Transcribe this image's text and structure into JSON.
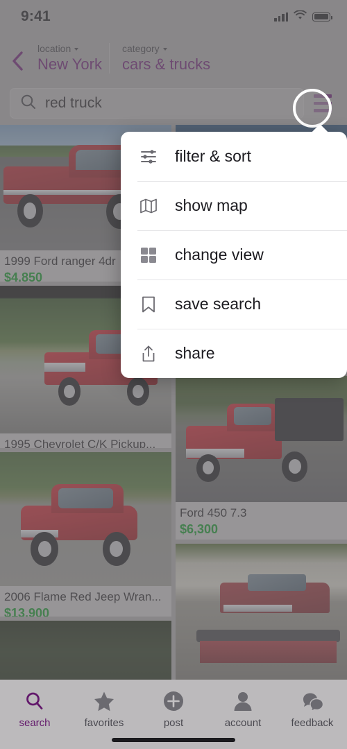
{
  "status_bar": {
    "time": "9:41",
    "icons": [
      "cellular-signal-icon",
      "wifi-icon",
      "battery-icon"
    ]
  },
  "header": {
    "back_icon": "back-chevron-icon",
    "location": {
      "kicker": "location",
      "value": "New York"
    },
    "category": {
      "kicker": "category",
      "value": "cars & trucks"
    }
  },
  "search": {
    "icon": "search-icon",
    "value": "red truck",
    "placeholder": "search",
    "menu_icon": "hamburger-menu-icon"
  },
  "menu": {
    "items": [
      {
        "label": "filter & sort",
        "icon": "sliders-icon"
      },
      {
        "label": "show map",
        "icon": "map-icon"
      },
      {
        "label": "change view",
        "icon": "grid-view-icon"
      },
      {
        "label": "save search",
        "icon": "bookmark-icon"
      },
      {
        "label": "share",
        "icon": "share-icon"
      }
    ]
  },
  "listings": {
    "left_column": [
      {
        "title": "1999 Ford ranger 4dr",
        "price": "$4,850"
      },
      {
        "title": "1995 Chevrolet C/K Pickup...",
        "price": ""
      },
      {
        "title": "2006 Flame Red Jeep Wran...",
        "price": "$13,900"
      },
      {
        "title": "",
        "price": ""
      }
    ],
    "right_column": [
      {
        "title": "",
        "price": ""
      },
      {
        "title": "Ford 450 7.3",
        "price": "$6,300"
      },
      {
        "title": "",
        "price": ""
      }
    ]
  },
  "tab_bar": {
    "tabs": [
      {
        "label": "search",
        "icon": "search-icon",
        "active": true
      },
      {
        "label": "favorites",
        "icon": "star-icon",
        "active": false
      },
      {
        "label": "post",
        "icon": "plus-circle-icon",
        "active": false
      },
      {
        "label": "account",
        "icon": "person-icon",
        "active": false
      },
      {
        "label": "feedback",
        "icon": "chat-bubbles-icon",
        "active": false
      }
    ]
  },
  "colors": {
    "accent": "#62186b",
    "price": "#0a8a21",
    "background": "#9e9b9e",
    "menu_background": "#ffffff"
  }
}
